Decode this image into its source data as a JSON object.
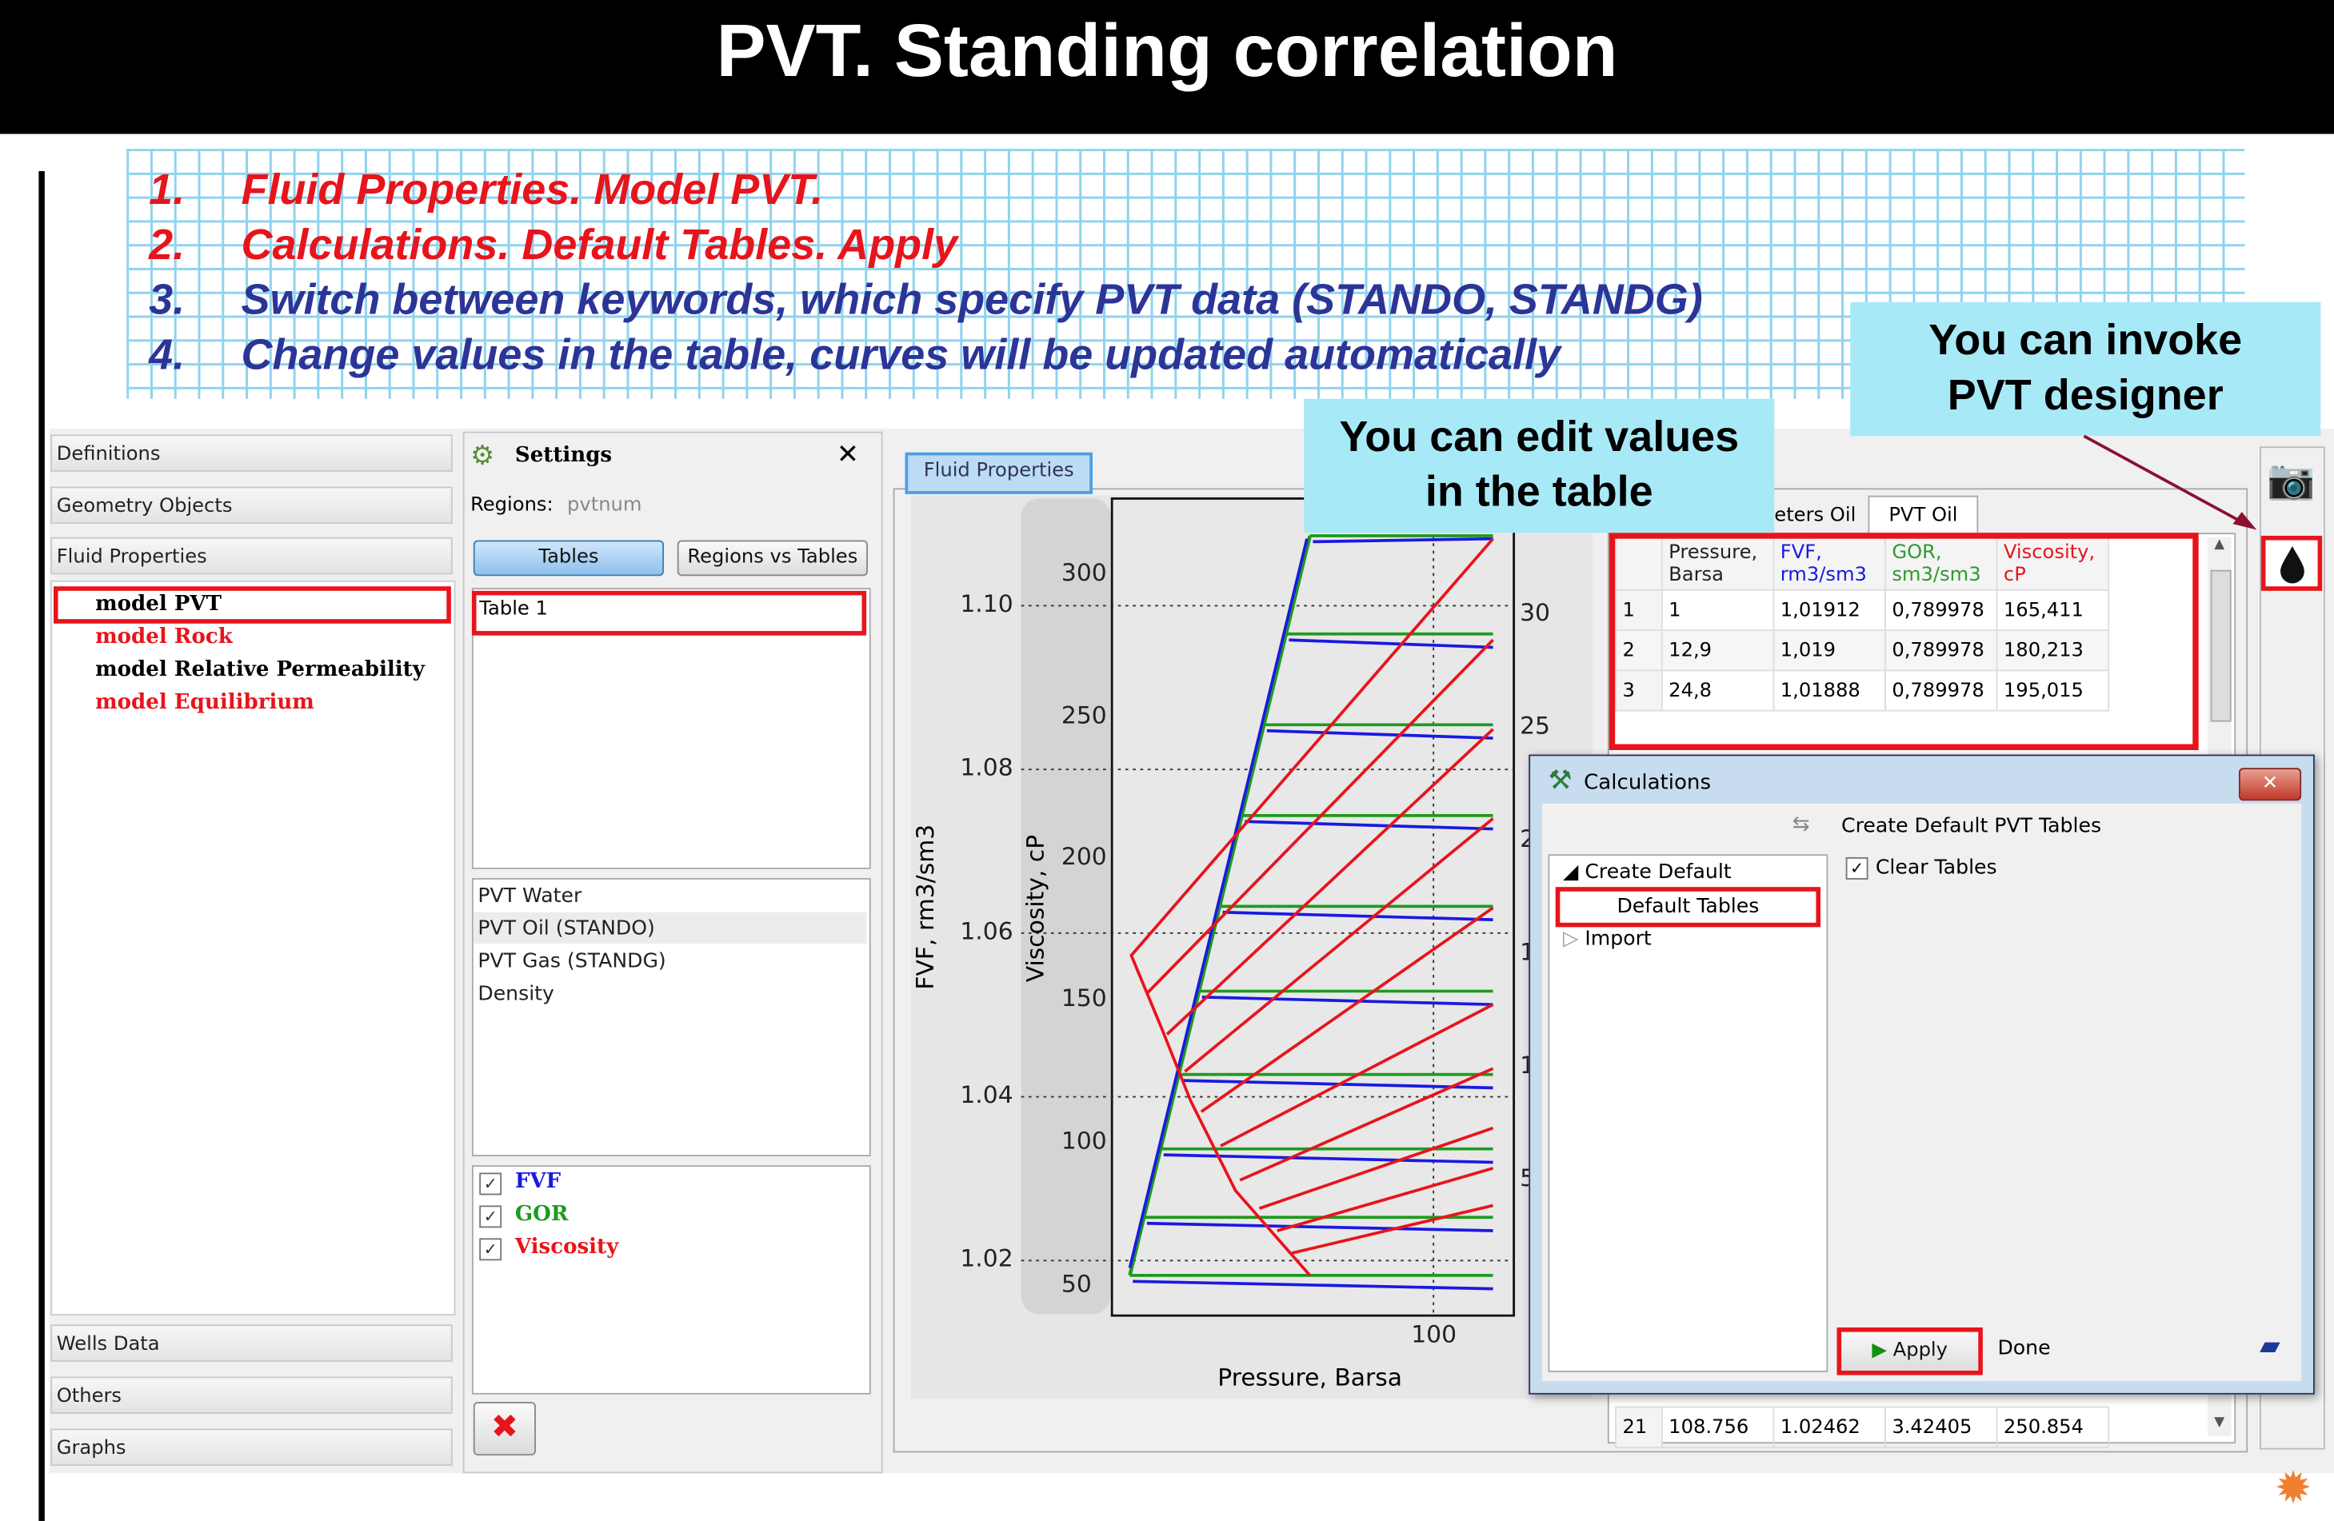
{
  "slide": {
    "title": "PVT. Standing correlation",
    "steps": [
      {
        "num": "1.",
        "text": "Fluid Properties. Model PVT."
      },
      {
        "num": "2.",
        "text": "Calculations. Default Tables. Apply"
      },
      {
        "num": "3.",
        "text": "Switch  between keywords, which specify PVT data (STANDO, STANDG)"
      },
      {
        "num": "4.",
        "text": "Change values in the table, curves will be updated automatically"
      }
    ],
    "callout_edit_line1": "You can edit values",
    "callout_edit_line2": "in the table",
    "callout_designer_line1": "You can invoke",
    "callout_designer_line2": "PVT designer"
  },
  "left_panel": {
    "sections": [
      "Definitions",
      "Geometry Objects",
      "Fluid Properties"
    ],
    "models": [
      {
        "label": "model PVT",
        "color": "#000000"
      },
      {
        "label": "model Rock",
        "color": "#e8141c"
      },
      {
        "label": "model Relative Permeability",
        "color": "#000000"
      },
      {
        "label": "model Equilibrium",
        "color": "#e8141c"
      }
    ],
    "bottom_sections": [
      "Wells Data",
      "Others",
      "Graphs"
    ]
  },
  "settings": {
    "title": "Settings",
    "regions_label": "Regions:",
    "regions_value": "pvtnum",
    "tabs": [
      "Tables",
      "Regions vs Tables"
    ],
    "tables": [
      "Table 1"
    ],
    "keywords": [
      "PVT Water",
      "PVT Oil (STANDO)",
      "PVT Gas (STANDG)",
      "Density"
    ],
    "curves": [
      {
        "label": "FVF",
        "checked": true,
        "color": "#1a1ae0"
      },
      {
        "label": "GOR",
        "checked": true,
        "color": "#1f9a1f"
      },
      {
        "label": "Viscosity",
        "checked": true,
        "color": "#e8141c"
      }
    ]
  },
  "main": {
    "tab": "Fluid Properties",
    "table_tabs": [
      "eters Oil",
      "PVT Oil"
    ]
  },
  "chart_data": {
    "type": "line",
    "xlabel": "Pressure, Barsa",
    "ylabel_left": "FVF, rm3/sm3",
    "ylabel_inner": "Viscosity, cP",
    "x_ticks": [
      "100"
    ],
    "fvf_ticks": [
      "1.10",
      "1.08",
      "1.06",
      "1.04",
      "1.02"
    ],
    "viscosity_ticks": [
      "300",
      "250",
      "200",
      "150",
      "100",
      "50"
    ],
    "gor_ticks": [
      "30",
      "25",
      "2",
      "1",
      "1",
      "5"
    ],
    "x_scale": "log",
    "grid": true,
    "series_colors": {
      "FVF": "#1a1ae0",
      "GOR": "#1f9a1f",
      "Viscosity": "#e8141c"
    }
  },
  "pvt_table": {
    "headers": [
      [
        "",
        ""
      ],
      [
        "Pressure,",
        "Barsa"
      ],
      [
        "FVF,",
        "rm3/sm3"
      ],
      [
        "GOR,",
        "sm3/sm3"
      ],
      [
        "Viscosity,",
        "cP"
      ]
    ],
    "header_colors": [
      "#222",
      "#222",
      "#1a1ae0",
      "#2f9a2f",
      "#e8141c"
    ],
    "rows": [
      [
        "1",
        "1",
        "1,01912",
        "0,789978",
        "165,411"
      ],
      [
        "2",
        "12,9",
        "1,019",
        "0,789978",
        "180,213"
      ],
      [
        "3",
        "24,8",
        "1,01888",
        "0,789978",
        "195,015"
      ]
    ],
    "last_row": [
      "21",
      "108.756",
      "1.02462",
      "3.42405",
      "250.854"
    ]
  },
  "calc_dialog": {
    "title": "Calculations",
    "header": "Create Default PVT Tables",
    "tree": [
      "Create Default",
      "Default Tables",
      "Import"
    ],
    "clear_tables_label": "Clear Tables",
    "clear_tables_checked": true,
    "apply": "Apply",
    "done": "Done"
  }
}
